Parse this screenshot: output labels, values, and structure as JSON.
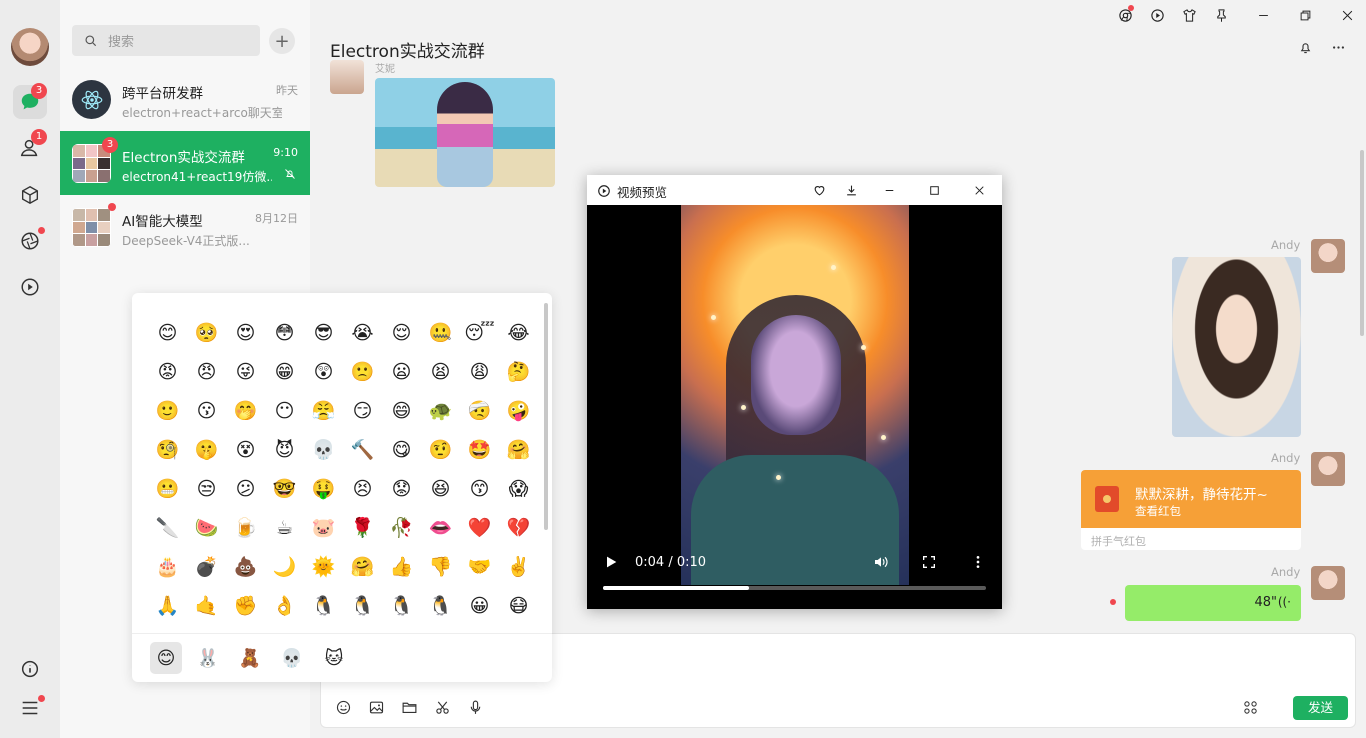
{
  "app": {
    "window_controls": [
      "chrome-icon",
      "play-icon",
      "shirt-icon",
      "pin-icon",
      "minimize",
      "maximize",
      "close"
    ]
  },
  "rail": {
    "chat_badge": "3",
    "contacts_badge": "1"
  },
  "search": {
    "placeholder": "搜索"
  },
  "conversations": [
    {
      "name": "跨平台研发群",
      "time": "昨天",
      "snippet": "electron+react+arco聊天室",
      "active": false
    },
    {
      "name": "Electron实战交流群",
      "time": "9:10",
      "snippet": "electron41+react19仿微...",
      "badge": "3",
      "active": true
    },
    {
      "name": "AI智能大模型",
      "time": "8月12日",
      "snippet": "DeepSeek-V4正式版...",
      "active": false
    }
  ],
  "chat": {
    "title": "Electron实战交流群",
    "top_sender": "艾妮",
    "sender": "Andy",
    "redpacket": {
      "wish": "默默深耕，静待花开~",
      "action": "查看红包",
      "type": "拼手气红包"
    },
    "voice": {
      "duration": "48\""
    }
  },
  "composer": {
    "send_label": "发送"
  },
  "emoji": {
    "grid": [
      "😊",
      "🥺",
      "😍",
      "😳",
      "😎",
      "😭",
      "😌",
      "🤐",
      "😴",
      "😂",
      "😡",
      "😠",
      "😜",
      "😁",
      "😲",
      "🙁",
      "😦",
      "😫",
      "😩",
      "🤔",
      "🙂",
      "😗",
      "🤭",
      "😶",
      "😤",
      "😏",
      "😄",
      "🐢",
      "🤕",
      "🤪",
      "🧐",
      "🤫",
      "😵",
      "😈",
      "💀",
      "🔨",
      "😋",
      "🤨",
      "🤩",
      "🤗",
      "😬",
      "😒",
      "😕",
      "🤓",
      "🤑",
      "😣",
      "😟",
      "😆",
      "😙",
      "😱",
      "🔪",
      "🍉",
      "🍺",
      "☕",
      "🐷",
      "🌹",
      "🥀",
      "👄",
      "❤️",
      "💔",
      "🎂",
      "💣",
      "💩",
      "🌙",
      "🌞",
      "🤗",
      "👍",
      "👎",
      "🤝",
      "✌️",
      "🙏",
      "🤙",
      "✊",
      "👌",
      "🐧",
      "🐧",
      "🐧",
      "🐧",
      "😀",
      "😷",
      "😊",
      "😊",
      "😊",
      "😊",
      "😊",
      "😊",
      "😊",
      "😊",
      "😊",
      "😊"
    ],
    "tabs": [
      "😊",
      "🐰",
      "🧸",
      "💀",
      "🐱"
    ]
  },
  "video": {
    "title": "视频预览",
    "time": "0:04 / 0:10",
    "progress": 0.38
  }
}
